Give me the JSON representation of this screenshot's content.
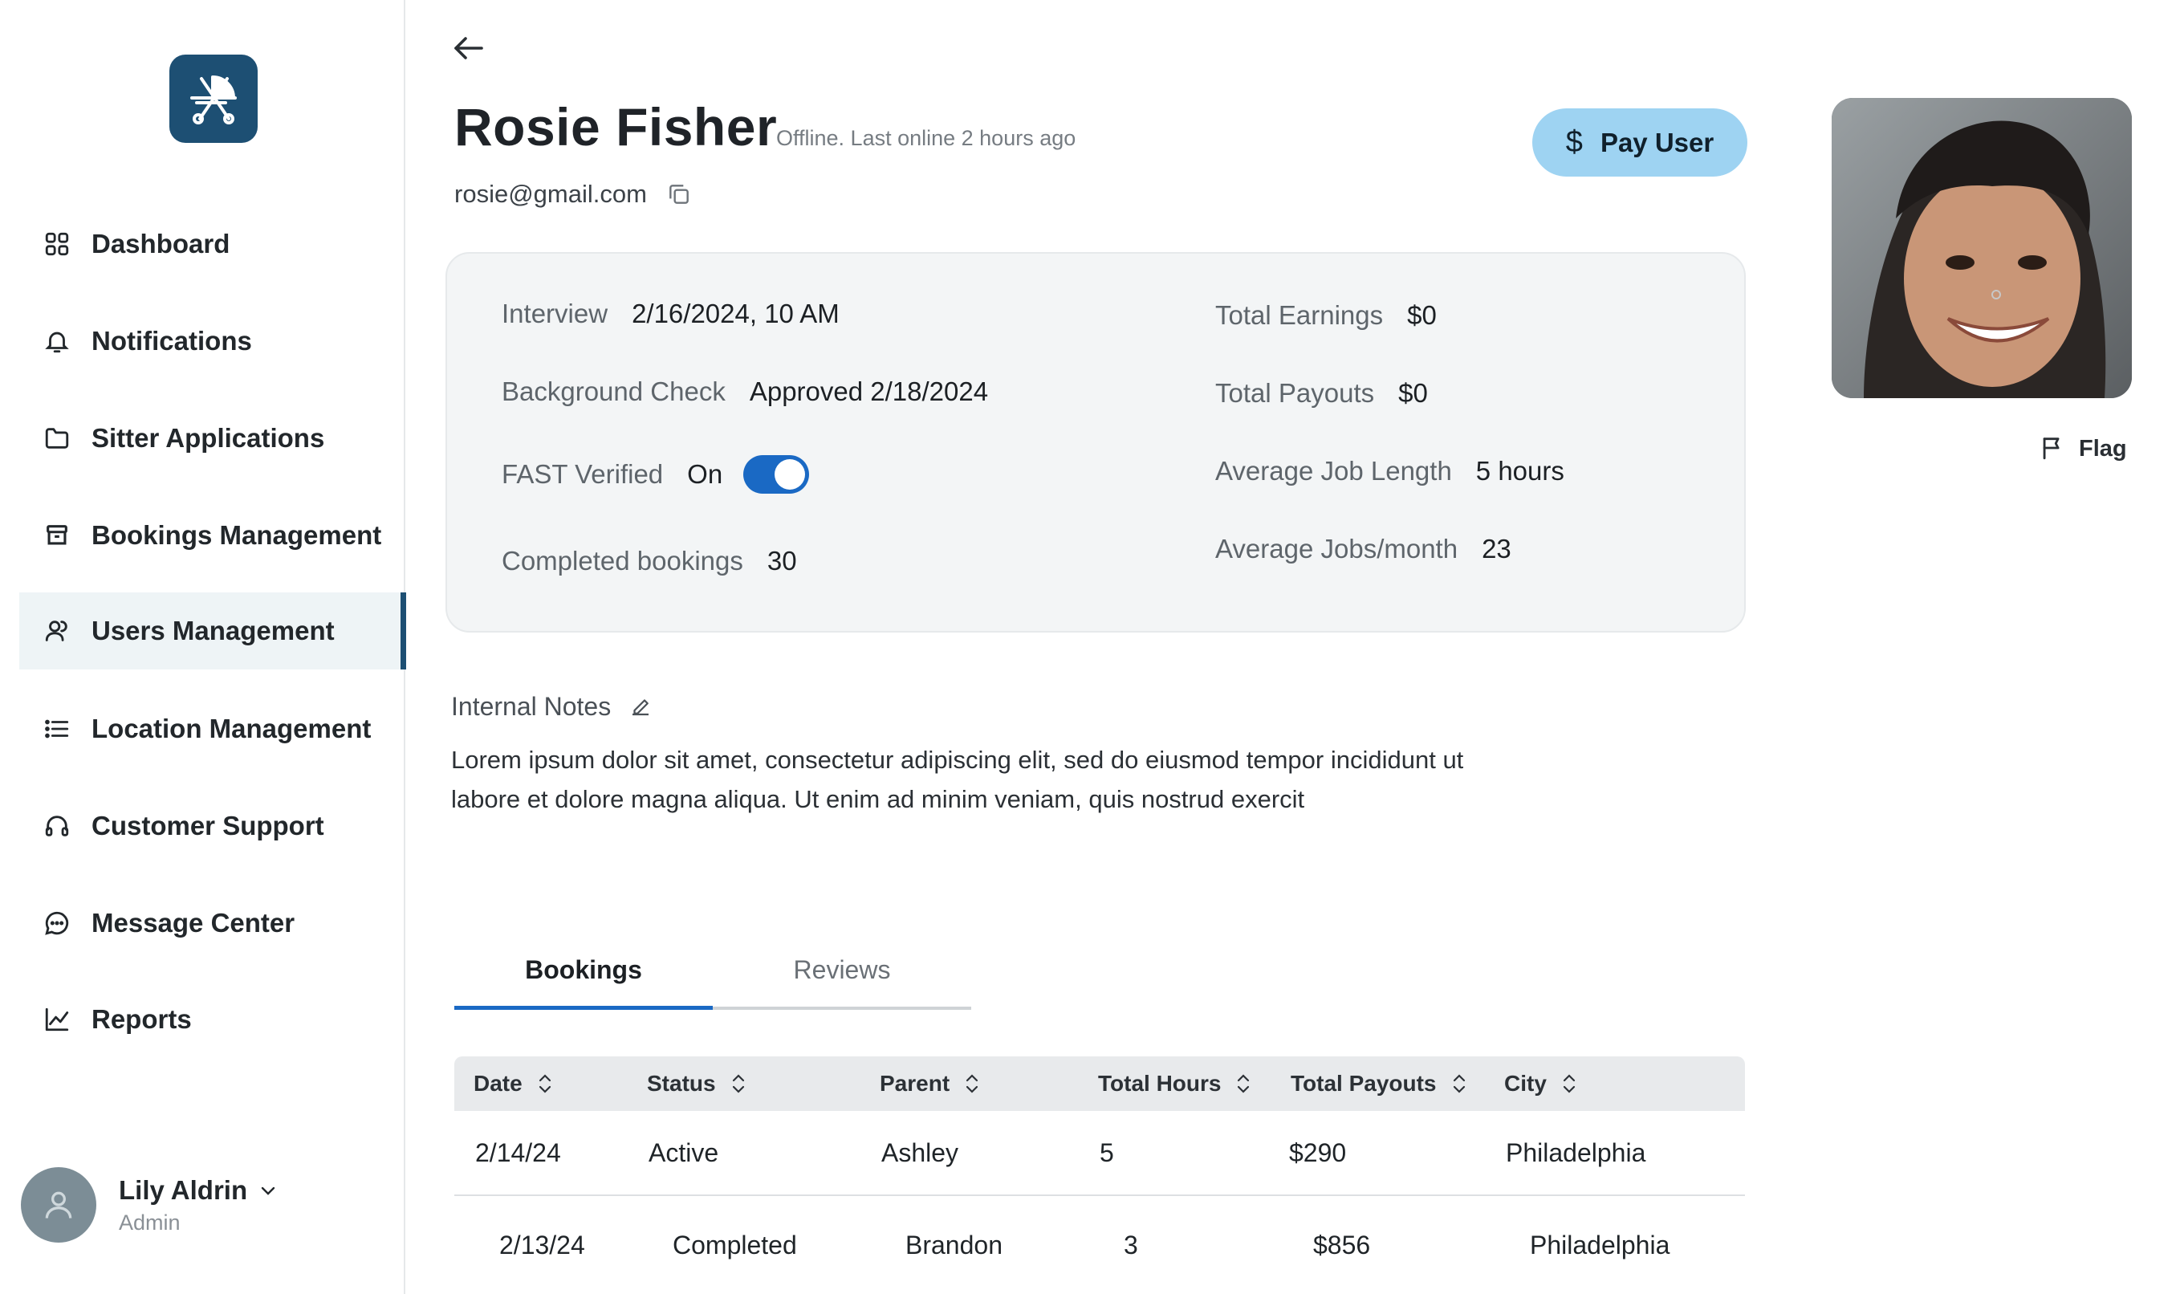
{
  "sidebar": {
    "logo_icon": "stroller-icon",
    "items": [
      {
        "label": "Dashboard",
        "icon": "grid-icon"
      },
      {
        "label": "Notifications",
        "icon": "bell-icon"
      },
      {
        "label": "Sitter Applications",
        "icon": "folder-icon"
      },
      {
        "label": "Bookings Management",
        "icon": "archive-icon"
      },
      {
        "label": "Users Management",
        "icon": "users-icon",
        "active": true
      },
      {
        "label": "Location Management",
        "icon": "list-icon"
      },
      {
        "label": "Customer Support",
        "icon": "headset-icon"
      },
      {
        "label": "Message Center",
        "icon": "chat-icon"
      },
      {
        "label": "Reports",
        "icon": "chart-icon"
      }
    ],
    "user": {
      "name": "Lily Aldrin",
      "role": "Admin"
    }
  },
  "header": {
    "name": "Rosie Fisher",
    "status": "Offline. Last online 2 hours ago",
    "email": "rosie@gmail.com",
    "pay_button": "Pay User",
    "pay_icon": "$",
    "flag_label": "Flag"
  },
  "details": {
    "interview": {
      "label": "Interview",
      "value": "2/16/2024, 10 AM"
    },
    "background": {
      "label": "Background Check",
      "value": "Approved 2/18/2024"
    },
    "fast": {
      "label": "FAST Verified",
      "value": "On",
      "enabled": true
    },
    "completed": {
      "label": "Completed bookings",
      "value": "30"
    },
    "earnings": {
      "label": "Total Earnings",
      "value": "$0"
    },
    "payouts": {
      "label": "Total Payouts",
      "value": "$0"
    },
    "avg_length": {
      "label": "Average Job Length",
      "value": "5 hours"
    },
    "avg_jobs": {
      "label": "Average Jobs/month",
      "value": "23"
    }
  },
  "notes": {
    "label": "Internal Notes",
    "line1": "Lorem ipsum dolor sit amet, consectetur adipiscing elit, sed do eiusmod tempor incididunt ut",
    "line2": "labore et dolore magna aliqua. Ut enim ad minim veniam, quis nostrud exercit"
  },
  "tabs": [
    {
      "label": "Bookings",
      "active": true
    },
    {
      "label": "Reviews",
      "active": false
    }
  ],
  "table": {
    "columns": [
      "Date",
      "Status",
      "Parent",
      "Total Hours",
      "Total Payouts",
      "City"
    ],
    "rows": [
      [
        "2/14/24",
        "Active",
        "Ashley",
        "5",
        "$290",
        "Philadelphia"
      ],
      [
        "2/13/24",
        "Completed",
        "Brandon",
        "3",
        "$856",
        "Philadelphia"
      ]
    ]
  },
  "colors": {
    "primary": "#1d4f73",
    "accent": "#1a69c4",
    "pay_button": "#9ed3f2",
    "active_nav_bg": "#eef4f6"
  }
}
